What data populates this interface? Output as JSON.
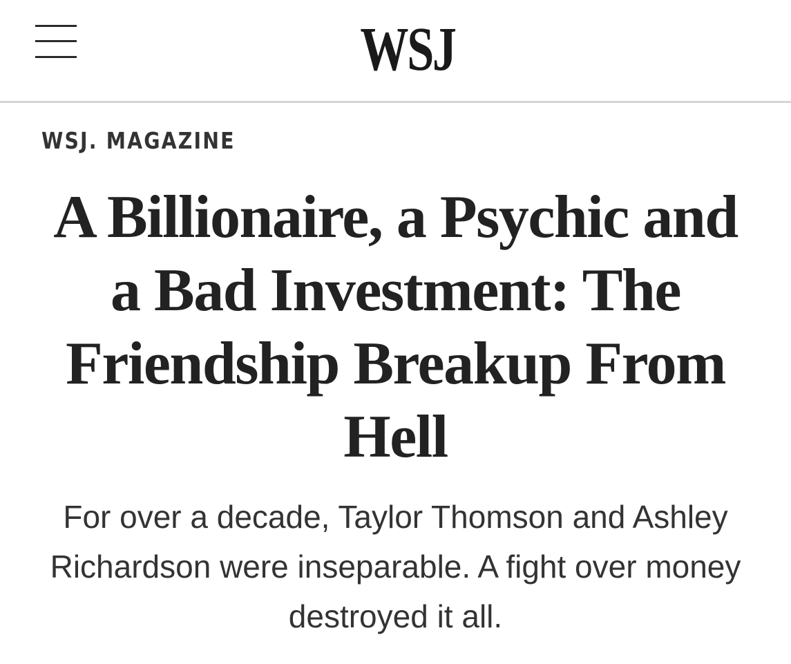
{
  "header": {
    "menu_icon": "hamburger-menu-icon",
    "logo_text": "WSJ"
  },
  "article": {
    "section": "WSJ. MAGAZINE",
    "headline": "A Billionaire, a Psychic and a Bad Investment: The Friendship Breakup From Hell",
    "dek": "For over a decade, Taylor Thomson and Ashley Richardson were inseparable. A fight over money destroyed it all."
  },
  "colors": {
    "background": "#ffffff",
    "text": "#222222",
    "divider": "#d4d4d4"
  }
}
